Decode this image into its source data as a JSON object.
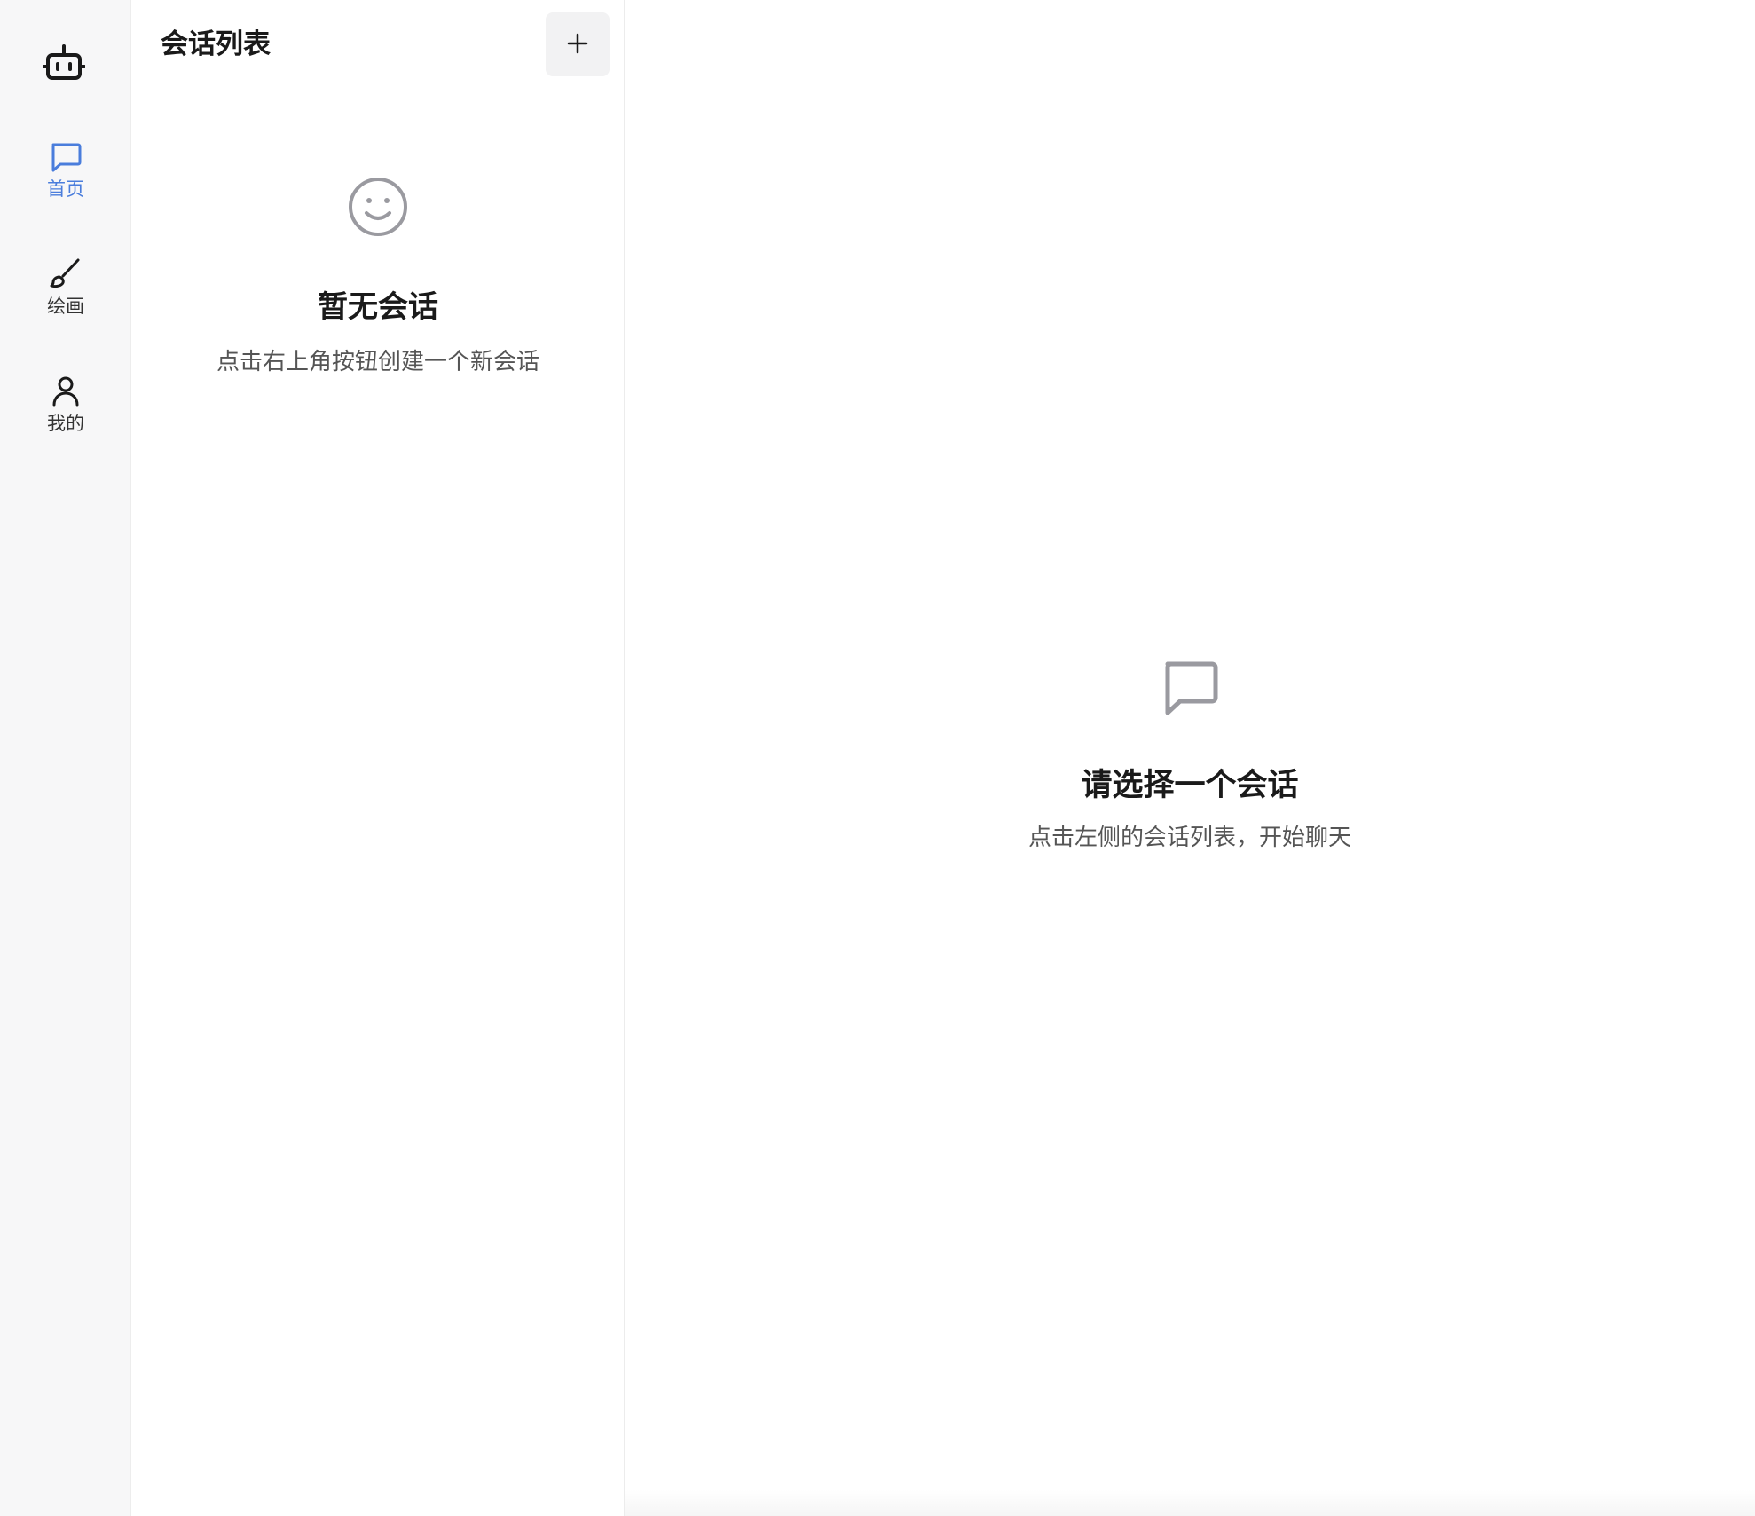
{
  "nav": {
    "logo_icon": "robot-icon",
    "items": [
      {
        "label": "首页",
        "icon": "chat-bubble-icon",
        "active": true
      },
      {
        "label": "绘画",
        "icon": "brush-icon",
        "active": false
      },
      {
        "label": "我的",
        "icon": "user-icon",
        "active": false
      }
    ]
  },
  "conversation_list": {
    "title": "会话列表",
    "add_button_icon": "plus-icon",
    "empty": {
      "icon": "smile-icon",
      "title": "暂无会话",
      "description": "点击右上角按钮创建一个新会话"
    }
  },
  "main": {
    "empty": {
      "icon": "chat-bubble-icon",
      "title": "请选择一个会话",
      "description": "点击左侧的会话列表，开始聊天"
    }
  },
  "colors": {
    "accent": "#4a7ddc",
    "rail_bg": "#f7f7f8",
    "text_primary": "#1a1a1a",
    "text_secondary": "#555555",
    "icon_muted": "#9a9aa0"
  }
}
